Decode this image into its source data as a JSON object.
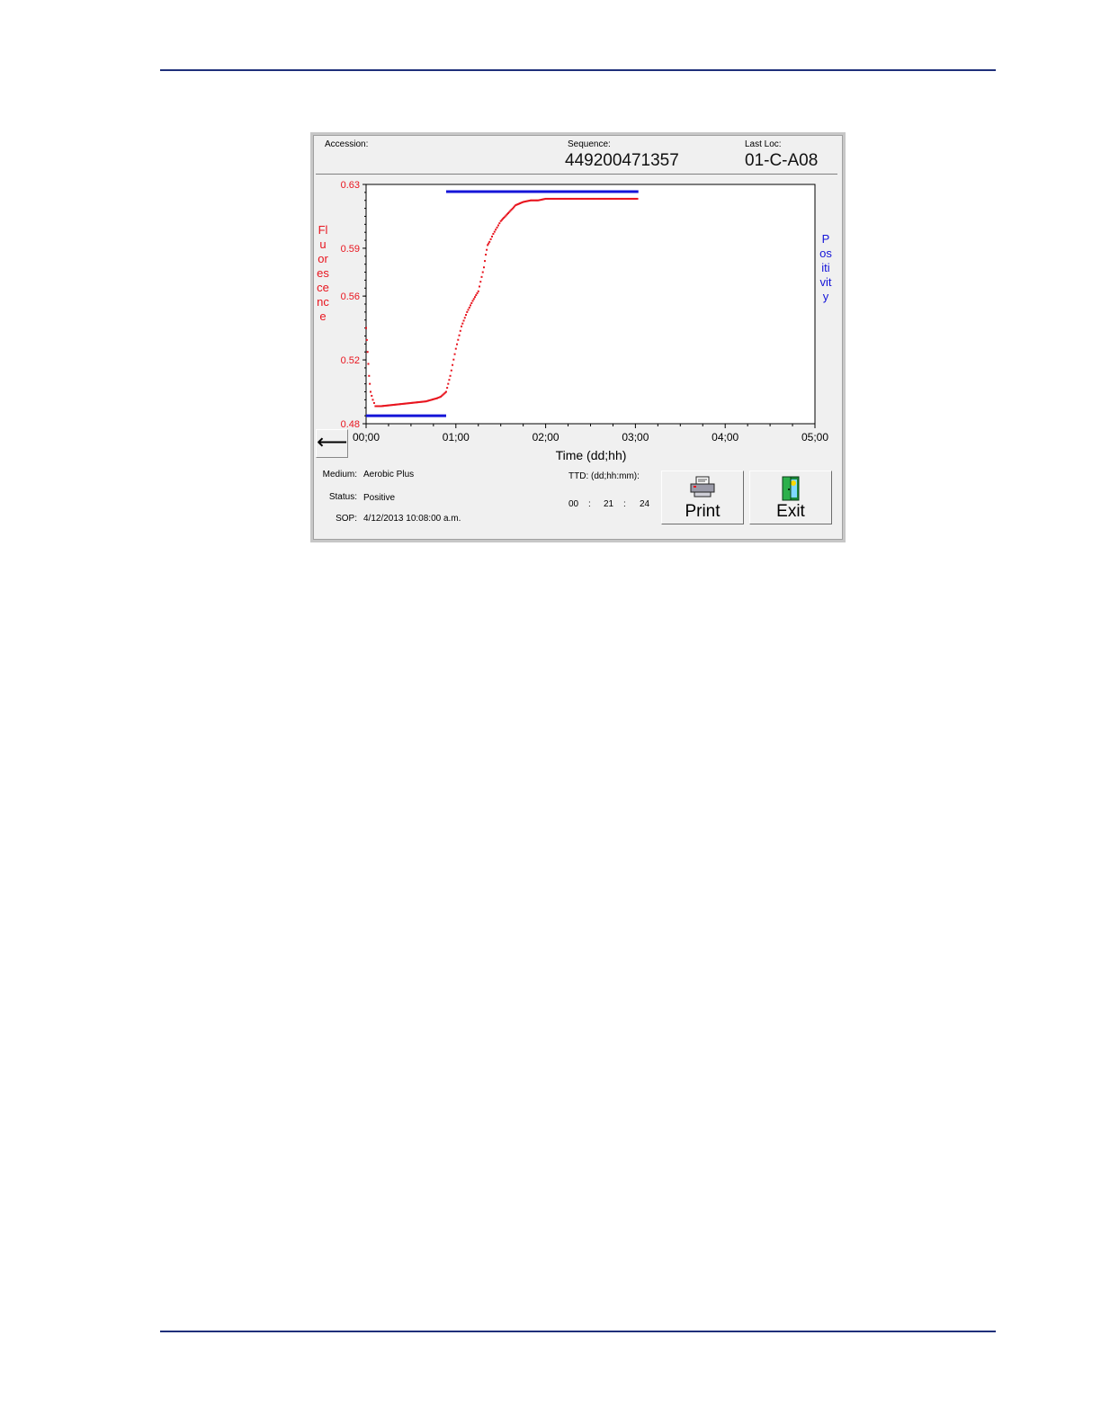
{
  "header": {
    "accession_label": "Accession:",
    "accession_value": "",
    "sequence_label": "Sequence:",
    "sequence_value": "449200471357",
    "lastloc_label": "Last Loc:",
    "lastloc_value": "01-C-A08"
  },
  "chart": {
    "y_axis_label": "Fluorescence",
    "right_axis_label": "Positivity",
    "x_axis_title": "Time (dd;hh)",
    "colors": {
      "fluorescence": "#e8141e",
      "positivity": "#1414d8"
    }
  },
  "chart_data": {
    "type": "line",
    "title": "",
    "xlabel": "Time (dd;hh)",
    "ylabel": "Fluorescence",
    "y2label": "Positivity",
    "x_unit": "hours",
    "xlim": [
      0,
      120
    ],
    "ylim": [
      0.48,
      0.63
    ],
    "x_tick_labels": [
      "00;00",
      "01;00",
      "02;00",
      "03;00",
      "04;00",
      "05;00"
    ],
    "x_tick_values": [
      0,
      24,
      48,
      72,
      96,
      120
    ],
    "y_tick_labels": [
      "0.48",
      "0.52",
      "0.56",
      "0.59",
      "0.63"
    ],
    "y_tick_values": [
      0.48,
      0.52,
      0.56,
      0.59,
      0.63
    ],
    "grid": false,
    "series": [
      {
        "name": "Fluorescence",
        "x": [
          0,
          0.4,
          0.8,
          1.2,
          1.8,
          2.5,
          4,
          8,
          12,
          16,
          19,
          20,
          21.4,
          22.5,
          24,
          25.5,
          27,
          28.5,
          30,
          31.5,
          32,
          32.5,
          33,
          34,
          35,
          36,
          38,
          40,
          42,
          44,
          46,
          48,
          52,
          56,
          60,
          64,
          68,
          72.8
        ],
        "y": [
          0.54,
          0.525,
          0.51,
          0.5,
          0.495,
          0.491,
          0.491,
          0.492,
          0.493,
          0.494,
          0.496,
          0.497,
          0.5,
          0.51,
          0.527,
          0.541,
          0.55,
          0.557,
          0.563,
          0.578,
          0.586,
          0.592,
          0.594,
          0.599,
          0.603,
          0.607,
          0.612,
          0.617,
          0.619,
          0.62,
          0.62,
          0.621,
          0.621,
          0.621,
          0.621,
          0.621,
          0.621,
          0.621
        ]
      },
      {
        "name": "Positivity",
        "segments": [
          {
            "x": [
              0,
              21.4
            ],
            "level": "negative"
          },
          {
            "x": [
              21.4,
              72.8
            ],
            "level": "positive"
          }
        ]
      }
    ]
  },
  "footer": {
    "medium_label": "Medium:",
    "medium_value": "Aerobic Plus",
    "status_label": "Status:",
    "status_value": "Positive",
    "sop_label": "SOP:",
    "sop_value": "4/12/2013 10:08:00 a.m.",
    "ttd_label": "TTD: (dd;hh:mm):",
    "ttd_dd": "00",
    "ttd_sep1": ":",
    "ttd_hh": "21",
    "ttd_sep2": ":",
    "ttd_mm": "24"
  },
  "buttons": {
    "back_icon": "left-arrow-icon",
    "back_glyph": "⟵",
    "print_label": "Print",
    "print_icon": "printer-icon",
    "exit_label": "Exit",
    "exit_icon": "exit-door-icon"
  }
}
